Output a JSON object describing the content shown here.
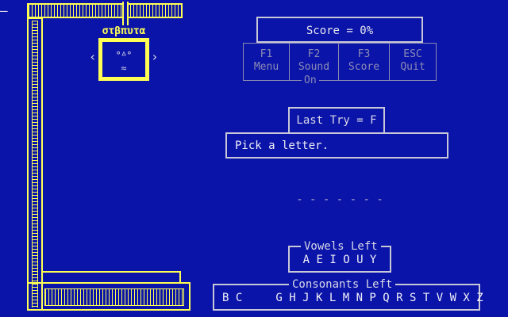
{
  "cursor_mark": "–",
  "hangman": {
    "hidden_word": "στβπυτα",
    "face": {
      "eyes": "°ᐞ°",
      "mouth": "≈"
    },
    "left_arrow": "‹",
    "right_arrow": "›"
  },
  "score": {
    "label": "Score = 0%"
  },
  "function_keys": [
    {
      "key": "F1",
      "label": "Menu"
    },
    {
      "key": "F2",
      "label": "Sound"
    },
    {
      "key": "F3",
      "label": "Score"
    },
    {
      "key": "ESC",
      "label": "Quit"
    }
  ],
  "sound_status": "On",
  "last_try": "Last Try = F",
  "message": "Pick a letter.",
  "word_blanks": "- - - - - - -",
  "vowels": {
    "title": "Vowels Left",
    "letters": "A E I O U Y"
  },
  "consonants": {
    "title": "Consonants Left",
    "letters": "B C     G H J K L M N P Q R S T V W X Z"
  },
  "colors": {
    "background": "#0a14a8",
    "gallows": "#ffff54",
    "text": "#d8d8e8",
    "dim": "#8c8cb4"
  }
}
